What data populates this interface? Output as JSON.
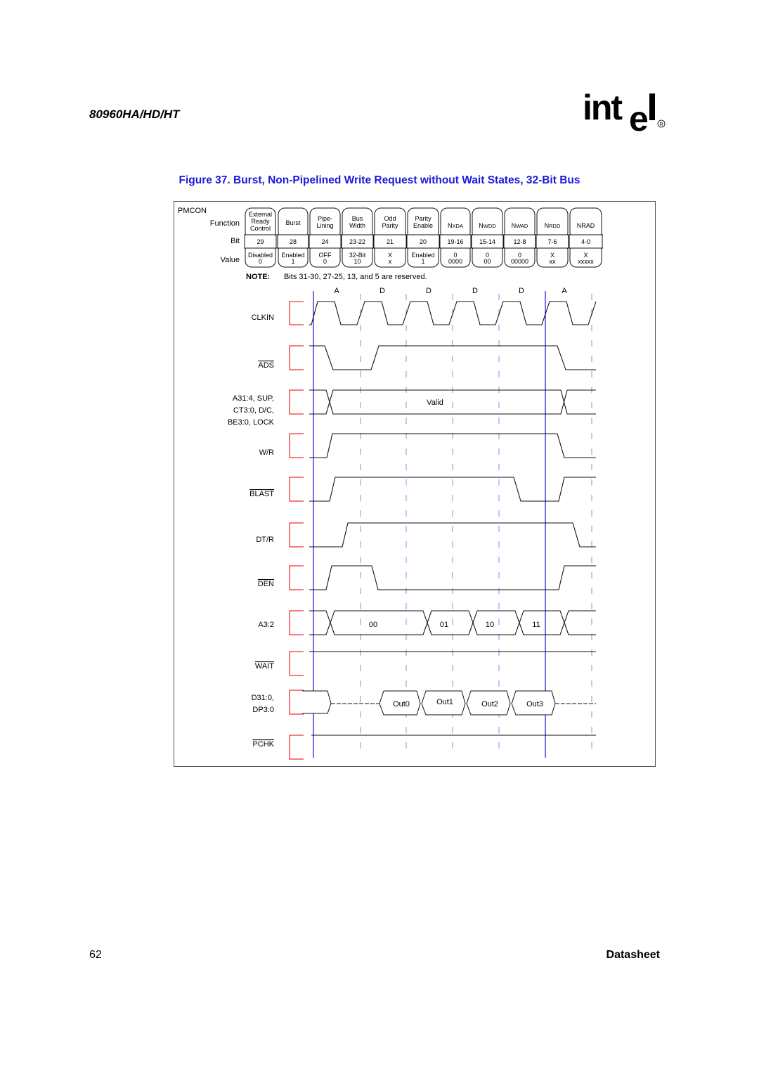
{
  "header": {
    "doc_title": "80960HA/HD/HT",
    "logo_text": "intel",
    "logo_registered": "®"
  },
  "figure": {
    "title": "Figure 37. Burst, Non-Pipelined Write Request without Wait States, 32-Bit Bus"
  },
  "pmcon": {
    "title": "PMCON",
    "row_labels": {
      "function": "Function",
      "bit": "Bit",
      "value": "Value"
    },
    "fields": [
      {
        "function": [
          "External",
          "Ready",
          "Control"
        ],
        "bit": "29",
        "value": [
          "Disabled",
          "0"
        ]
      },
      {
        "function": [
          "Burst"
        ],
        "bit": "28",
        "value": [
          "Enabled",
          "1"
        ]
      },
      {
        "function": [
          "Pipe-",
          "Lining"
        ],
        "bit": "24",
        "value": [
          "OFF",
          "0"
        ]
      },
      {
        "function": [
          "Bus",
          "Width"
        ],
        "bit": "23-22",
        "value": [
          "32-Bit",
          "10"
        ]
      },
      {
        "function": [
          "Odd",
          "Parity"
        ],
        "bit": "21",
        "value": [
          "X",
          "x"
        ]
      },
      {
        "function": [
          "Parity",
          "Enable"
        ],
        "bit": "20",
        "value": [
          "Enabled",
          "1"
        ]
      },
      {
        "function_main": "N",
        "function_sub": "XDA",
        "bit": "19-16",
        "value": [
          "0",
          "0000"
        ]
      },
      {
        "function_main": "N",
        "function_sub": "WDD",
        "bit": "15-14",
        "value": [
          "0",
          "00"
        ]
      },
      {
        "function_main": "N",
        "function_sub": "WAD",
        "bit": "12-8",
        "value": [
          "0",
          "00000"
        ]
      },
      {
        "function_main": "N",
        "function_sub": "RDD",
        "bit": "7-6",
        "value": [
          "X",
          "xx"
        ]
      },
      {
        "function_main": "N",
        "function_sub": "RAD",
        "bit": "4-0",
        "value": [
          "X",
          "xxxxx"
        ]
      }
    ],
    "note_label": "NOTE:",
    "note_text": "Bits 31-30, 27-25, 13, and 5 are reserved."
  },
  "timing": {
    "phases": [
      "A",
      "D",
      "D",
      "D",
      "D",
      "A"
    ],
    "signals": [
      {
        "id": "clkin",
        "label": [
          "CLKIN"
        ],
        "overline": [
          false
        ]
      },
      {
        "id": "ads",
        "label": [
          "ADS"
        ],
        "overline": [
          true
        ]
      },
      {
        "id": "addr",
        "label": [
          "A31:4, SUP,",
          "CT3:0, D/C,",
          "BE3:0, LOCK"
        ],
        "bus_text": "Valid"
      },
      {
        "id": "wr",
        "label": [
          "W/R"
        ]
      },
      {
        "id": "blast",
        "label": [
          "BLAST"
        ],
        "overline": [
          true
        ]
      },
      {
        "id": "dtr",
        "label": [
          "DT/R"
        ]
      },
      {
        "id": "den",
        "label": [
          "DEN"
        ],
        "overline": [
          true
        ]
      },
      {
        "id": "a32",
        "label": [
          "A3:2"
        ],
        "bus_values": [
          "00",
          "01",
          "10",
          "11"
        ]
      },
      {
        "id": "wait",
        "label": [
          "WAIT"
        ],
        "overline": [
          true
        ]
      },
      {
        "id": "data",
        "label": [
          "D31:0,",
          "DP3:0"
        ],
        "bus_values": [
          "Out0",
          "Out1",
          "Out2",
          "Out3"
        ]
      },
      {
        "id": "pchk",
        "label": [
          "PCHK"
        ],
        "overline": [
          true
        ]
      }
    ]
  },
  "footer": {
    "page_number": "62",
    "doc_type": "Datasheet"
  },
  "colors": {
    "figure_title": "#1a1adb",
    "solid_marker": "#2222dd",
    "dashed_marker": "#8888ee",
    "bracket": "#ee3333"
  }
}
